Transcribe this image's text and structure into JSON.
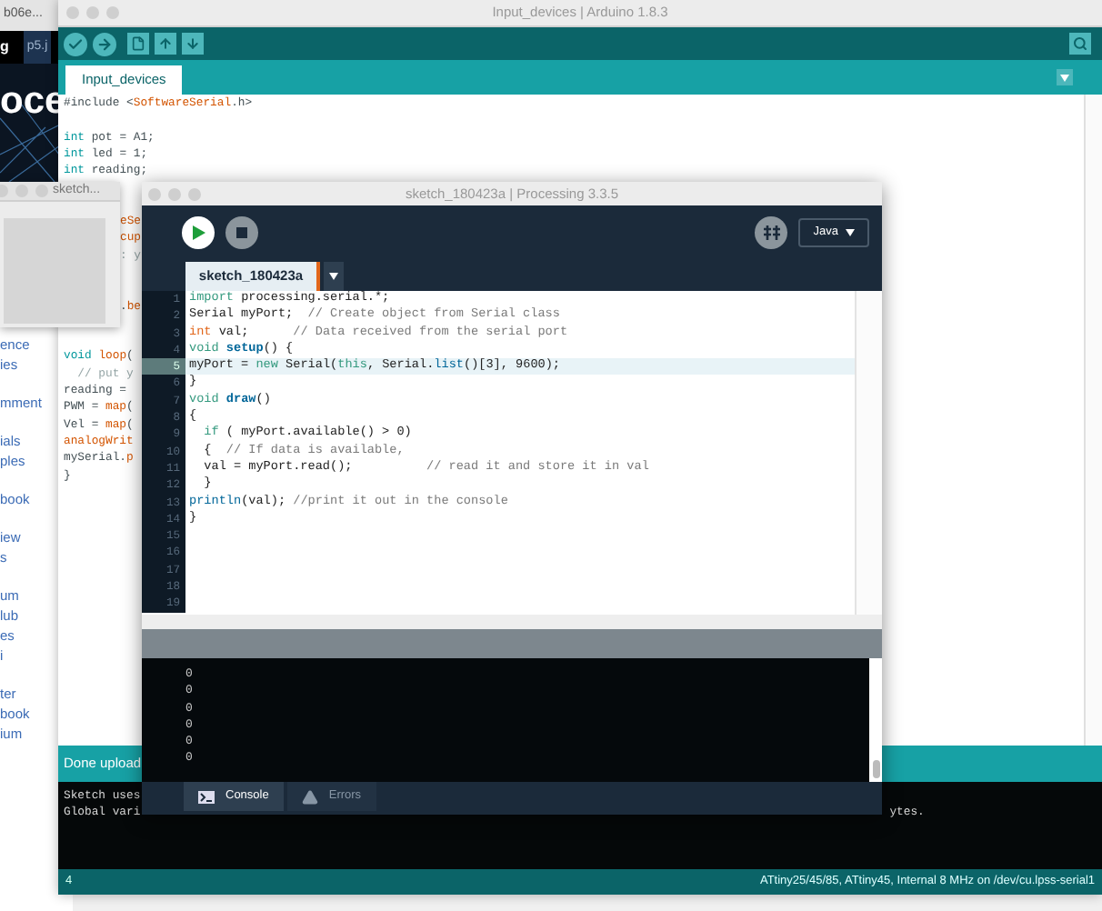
{
  "browser": {
    "tab_1": "b06e...",
    "tab_2": "p5.j",
    "corner_text": "g",
    "hero_text": "oce",
    "link_groups": [
      [
        "ence",
        "ies"
      ],
      [
        "mment"
      ],
      [
        "ials",
        "ples"
      ],
      [
        "book"
      ],
      [
        "iew",
        "s"
      ],
      [
        "um",
        "lub",
        "es",
        "i"
      ],
      [
        "ter",
        "book",
        "ium"
      ]
    ]
  },
  "arduino": {
    "title": "Input_devices | Arduino 1.8.3",
    "tab": "Input_devices",
    "code": [
      {
        "kind": "code",
        "tokens": [
          {
            "kind": "plain",
            "text": "#include <"
          },
          {
            "kind": "func",
            "text": "SoftwareSerial"
          },
          {
            "kind": "plain",
            "text": ".h>"
          }
        ]
      },
      {
        "kind": "blank"
      },
      {
        "kind": "code",
        "tokens": [
          {
            "kind": "type",
            "text": "int"
          },
          {
            "kind": "plain",
            "text": " pot = A1;"
          }
        ]
      },
      {
        "kind": "code",
        "tokens": [
          {
            "kind": "type",
            "text": "int"
          },
          {
            "kind": "plain",
            "text": " led = 1;"
          }
        ]
      },
      {
        "kind": "code",
        "tokens": [
          {
            "kind": "type",
            "text": "int"
          },
          {
            "kind": "plain",
            "text": " reading;"
          }
        ]
      },
      {
        "kind": "blank"
      },
      {
        "kind": "blank"
      },
      {
        "kind": "fragment",
        "tokens": [
          {
            "kind": "func",
            "text": "eSe"
          }
        ]
      },
      {
        "kind": "fragment",
        "tokens": [
          {
            "kind": "func",
            "text": "cup"
          }
        ]
      },
      {
        "kind": "fragment",
        "tokens": [
          {
            "kind": "comment",
            "text": ": y"
          }
        ]
      },
      {
        "kind": "blank"
      },
      {
        "kind": "blank"
      },
      {
        "kind": "fragment",
        "tokens": [
          {
            "kind": "plain",
            "text": "."
          },
          {
            "kind": "func",
            "text": "be"
          }
        ]
      },
      {
        "kind": "blank"
      },
      {
        "kind": "blank"
      },
      {
        "kind": "code",
        "tokens": [
          {
            "kind": "type",
            "text": "void "
          },
          {
            "kind": "func",
            "text": "loop"
          },
          {
            "kind": "plain",
            "text": "("
          }
        ]
      },
      {
        "kind": "code",
        "tokens": [
          {
            "kind": "comment",
            "text": "  // put y"
          }
        ]
      },
      {
        "kind": "code",
        "tokens": [
          {
            "kind": "plain",
            "text": "reading = "
          }
        ]
      },
      {
        "kind": "code",
        "tokens": [
          {
            "kind": "plain",
            "text": "PWM = "
          },
          {
            "kind": "func",
            "text": "map"
          },
          {
            "kind": "plain",
            "text": "("
          }
        ]
      },
      {
        "kind": "code",
        "tokens": [
          {
            "kind": "plain",
            "text": "Vel = "
          },
          {
            "kind": "func",
            "text": "map"
          },
          {
            "kind": "plain",
            "text": "("
          }
        ]
      },
      {
        "kind": "code",
        "tokens": [
          {
            "kind": "func",
            "text": "analogWrit"
          }
        ]
      },
      {
        "kind": "code",
        "tokens": [
          {
            "kind": "plain",
            "text": "mySerial."
          },
          {
            "kind": "func",
            "text": "p"
          }
        ]
      },
      {
        "kind": "code",
        "tokens": [
          {
            "kind": "plain",
            "text": "}"
          }
        ]
      }
    ],
    "status": "Done upload",
    "console": {
      "line_1": "Sketch uses",
      "line_2_left": "Global vari",
      "line_2_right": "ytes."
    },
    "status_bar": {
      "line": "4",
      "board": "ATtiny25/45/85, ATtiny45, Internal 8 MHz on /dev/cu.lpss-serial1"
    }
  },
  "sketch_window": {
    "title": "sketch..."
  },
  "processing": {
    "title": "sketch_180423a | Processing 3.3.5",
    "mode": "Java",
    "tab": "sketch_180423a",
    "lines": [
      {
        "number": "1",
        "highlighted": false,
        "tokens": [
          {
            "kind": "keyword",
            "text": "import"
          },
          {
            "kind": "plain",
            "text": " processing.serial.*;"
          }
        ]
      },
      {
        "number": "2",
        "highlighted": false,
        "tokens": [
          {
            "kind": "plain",
            "text": "Serial myPort;  "
          },
          {
            "kind": "comment",
            "text": "// Create object from Serial class"
          }
        ]
      },
      {
        "number": "3",
        "highlighted": false,
        "tokens": [
          {
            "kind": "type",
            "text": "int"
          },
          {
            "kind": "plain",
            "text": " val;      "
          },
          {
            "kind": "comment",
            "text": "// Data received from the serial port"
          }
        ]
      },
      {
        "number": "4",
        "highlighted": false,
        "tokens": [
          {
            "kind": "keyword",
            "text": "void "
          },
          {
            "kind": "function",
            "text": "setup"
          },
          {
            "kind": "plain",
            "text": "() {"
          }
        ]
      },
      {
        "number": "5",
        "highlighted": true,
        "tokens": [
          {
            "kind": "plain",
            "text": "myPort = "
          },
          {
            "kind": "keyword",
            "text": "new"
          },
          {
            "kind": "plain",
            "text": " Serial("
          },
          {
            "kind": "keyword",
            "text": "this"
          },
          {
            "kind": "plain",
            "text": ", Serial."
          },
          {
            "kind": "method",
            "text": "list"
          },
          {
            "kind": "plain",
            "text": "()[3], 9600);"
          }
        ]
      },
      {
        "number": "6",
        "highlighted": false,
        "tokens": [
          {
            "kind": "plain",
            "text": "}"
          }
        ]
      },
      {
        "number": "7",
        "highlighted": false,
        "tokens": [
          {
            "kind": "keyword",
            "text": "void "
          },
          {
            "kind": "function",
            "text": "draw"
          },
          {
            "kind": "plain",
            "text": "()"
          }
        ]
      },
      {
        "number": "8",
        "highlighted": false,
        "tokens": [
          {
            "kind": "plain",
            "text": "{"
          }
        ]
      },
      {
        "number": "9",
        "highlighted": false,
        "tokens": [
          {
            "kind": "keyword",
            "text": "  if"
          },
          {
            "kind": "plain",
            "text": " ( myPort.available() > 0)"
          }
        ]
      },
      {
        "number": "10",
        "highlighted": false,
        "tokens": [
          {
            "kind": "plain",
            "text": "  {  "
          },
          {
            "kind": "comment",
            "text": "// If data is available,"
          }
        ]
      },
      {
        "number": "11",
        "highlighted": false,
        "tokens": [
          {
            "kind": "plain",
            "text": "  val = myPort.read();          "
          },
          {
            "kind": "comment",
            "text": "// read it and store it in val"
          }
        ]
      },
      {
        "number": "12",
        "highlighted": false,
        "tokens": [
          {
            "kind": "plain",
            "text": "  }"
          }
        ]
      },
      {
        "number": "13",
        "highlighted": false,
        "tokens": [
          {
            "kind": "method",
            "text": "println"
          },
          {
            "kind": "plain",
            "text": "(val); "
          },
          {
            "kind": "comment",
            "text": "//print it out in the console"
          }
        ]
      },
      {
        "number": "14",
        "highlighted": false,
        "tokens": [
          {
            "kind": "plain",
            "text": "}"
          }
        ]
      },
      {
        "number": "15",
        "highlighted": false
      },
      {
        "number": "16",
        "highlighted": false
      },
      {
        "number": "17",
        "highlighted": false
      },
      {
        "number": "18",
        "highlighted": false
      },
      {
        "number": "19",
        "highlighted": false
      }
    ],
    "console": [
      "0",
      "0",
      "0",
      "0",
      "0",
      "0"
    ],
    "bottom_tabs": [
      {
        "kind": "console",
        "label": "Console",
        "selected": true
      },
      {
        "kind": "errors",
        "label": "Errors",
        "selected": false
      }
    ]
  }
}
